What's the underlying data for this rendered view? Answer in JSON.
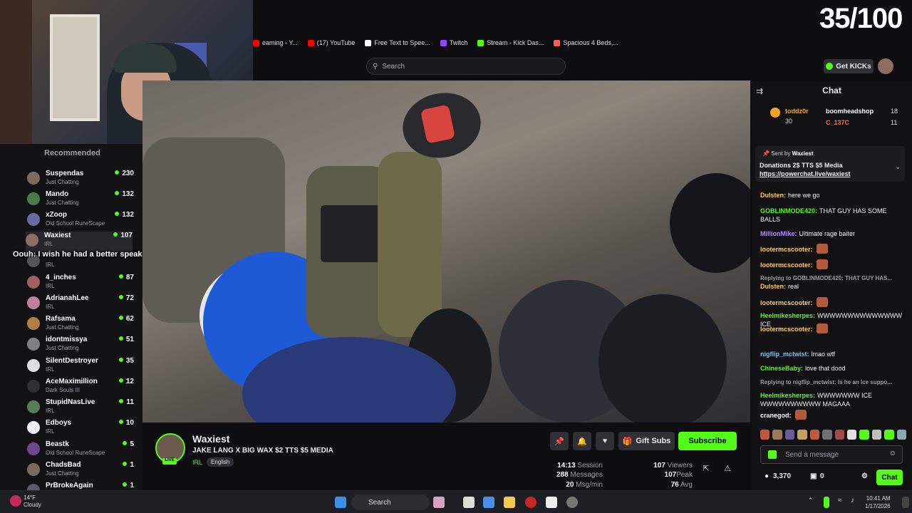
{
  "bookmarks": [
    {
      "label": "eaming - Y...",
      "color": "#ff0000"
    },
    {
      "label": "(17) YouTube",
      "color": "#ff0000"
    },
    {
      "label": "Free Text to Spee...",
      "color": "#ffffff"
    },
    {
      "label": "Twitch",
      "color": "#9147ff"
    },
    {
      "label": "Stream - Kick Das...",
      "color": "#53fc18"
    },
    {
      "label": "Spacious 4 Beds,...",
      "color": "#ff5a5f"
    }
  ],
  "search": {
    "placeholder": "Search"
  },
  "counter": "35/100",
  "header": {
    "get_kicks": "Get KICKs"
  },
  "sidebar": {
    "title": "Recommended",
    "items": [
      {
        "name": "Suspendas",
        "category": "Just Chatting",
        "viewers": "230",
        "color": "#7b6b5e"
      },
      {
        "name": "Mando",
        "category": "Just Chatting",
        "viewers": "132",
        "color": "#4a7a4a"
      },
      {
        "name": "xZoop",
        "category": "Old School RuneScape",
        "viewers": "132",
        "color": "#6a6aa0"
      },
      {
        "name": "Waxiest",
        "category": "IRL",
        "viewers": "107",
        "color": "#8d6e63"
      },
      {
        "name": "",
        "category": "IRL",
        "viewers": "",
        "color": "#555"
      },
      {
        "name": "4_inches",
        "category": "IRL",
        "viewers": "87",
        "color": "#a06060"
      },
      {
        "name": "AdrianahLee",
        "category": "IRL",
        "viewers": "72",
        "color": "#c080a0"
      },
      {
        "name": "Rafsama",
        "category": "Just Chatting",
        "viewers": "62",
        "color": "#b08040"
      },
      {
        "name": "idontmissya",
        "category": "Just Chatting",
        "viewers": "51",
        "color": "#808080"
      },
      {
        "name": "SilentDestroyer",
        "category": "IRL",
        "viewers": "35",
        "color": "#e0e0e0"
      },
      {
        "name": "AceMaximillion",
        "category": "Dark Souls III",
        "viewers": "12",
        "color": "#303030"
      },
      {
        "name": "StupidNasLive",
        "category": "IRL",
        "viewers": "11",
        "color": "#5a7a5a"
      },
      {
        "name": "Edboys",
        "category": "IRL",
        "viewers": "10",
        "color": "#f0f0f0"
      },
      {
        "name": "Beastk",
        "category": "Old School RuneScape",
        "viewers": "5",
        "color": "#6a4a8a"
      },
      {
        "name": "ChadsBad",
        "category": "Just Chatting",
        "viewers": "1",
        "color": "#7a6a5a"
      },
      {
        "name": "PrBrokeAgain",
        "category": "",
        "viewers": "1",
        "color": "#5a5a6a"
      }
    ]
  },
  "overlay_text": "Oouh: I wish he had a better speaker",
  "stream": {
    "channel": "Waxiest",
    "live_badge": "LIVE",
    "title": "JAKE LANG X BIG WAX $2 TTS $5 MEDIA",
    "category": "IRL",
    "language": "English",
    "gift_subs": "Gift Subs",
    "subscribe": "Subscribe",
    "stats": {
      "session": "14:13",
      "session_label": "Session",
      "messages": "288",
      "messages_label": "Messages",
      "msg_min": "20",
      "msg_min_label": "Msg/min",
      "viewers": "107",
      "viewers_label": "Viewers",
      "peak": "107",
      "peak_label": "Peak",
      "avg": "76",
      "avg_label": "Avg"
    }
  },
  "chat": {
    "title": "Chat",
    "gifters": [
      {
        "name": "toddz0r",
        "count": "30"
      },
      {
        "name": "boomheadshop",
        "count": "18"
      },
      {
        "name": "C_137C",
        "count": "11"
      }
    ],
    "pinned": {
      "sent_by_label": "Sent by",
      "sent_by": "Waxiest",
      "text": "Donations 2$ TTS $5 Media",
      "link": "https://powerchat.live/waxiest"
    },
    "messages": [
      {
        "user": "Dulsten:",
        "color": "#ffcc66",
        "text": "here we go"
      },
      {
        "user": "GOBLINMODE420:",
        "color": "#53fc18",
        "text": "THAT GUY HAS SOME BALLS"
      },
      {
        "user": "MillionMike:",
        "color": "#b388ff",
        "text": "Ultimate rage baiter"
      },
      {
        "user": "lootermcscooter:",
        "color": "#ffcc66",
        "text": ""
      },
      {
        "user": "lootermcscooter:",
        "color": "#ffcc66",
        "text": ""
      },
      {
        "user": "Replying to GOBLINMODE420: THAT GUY HAS...",
        "color": "#9a9aa2",
        "text": ""
      },
      {
        "user": "Dulsten:",
        "color": "#ffcc66",
        "text": "real"
      },
      {
        "user": "lootermcscooter:",
        "color": "#ffcc66",
        "text": ""
      },
      {
        "user": "Heelmikesherpes:",
        "color": "#53fc18",
        "text": "WWWWWWWWWWWWWW ICE"
      },
      {
        "user": "lootermcscooter:",
        "color": "#ffcc66",
        "text": ""
      },
      {
        "user": "nigflip_mctwist:",
        "color": "#66ccff",
        "text": "lmao wtf"
      },
      {
        "user": "ChineseBaby:",
        "color": "#53fc18",
        "text": "love that dood"
      },
      {
        "user": "Replying to nigflip_mctwist: Is he an Ice suppo...",
        "color": "#9a9aa2",
        "text": ""
      },
      {
        "user": "Heelmikesherpes:",
        "color": "#53fc18",
        "text": "WWWWWWW ICE WWWWWWWWWW MAGAAA"
      },
      {
        "user": "cranegod:",
        "color": "#ffffff",
        "text": ""
      }
    ],
    "input_placeholder": "Send a message",
    "points": "3,370",
    "redeem_count": "0",
    "send": "Chat"
  },
  "taskbar": {
    "temp": "14°F",
    "weather": "Cloudy",
    "search": "Search",
    "time": "10:41 AM",
    "date": "1/17/2026"
  }
}
